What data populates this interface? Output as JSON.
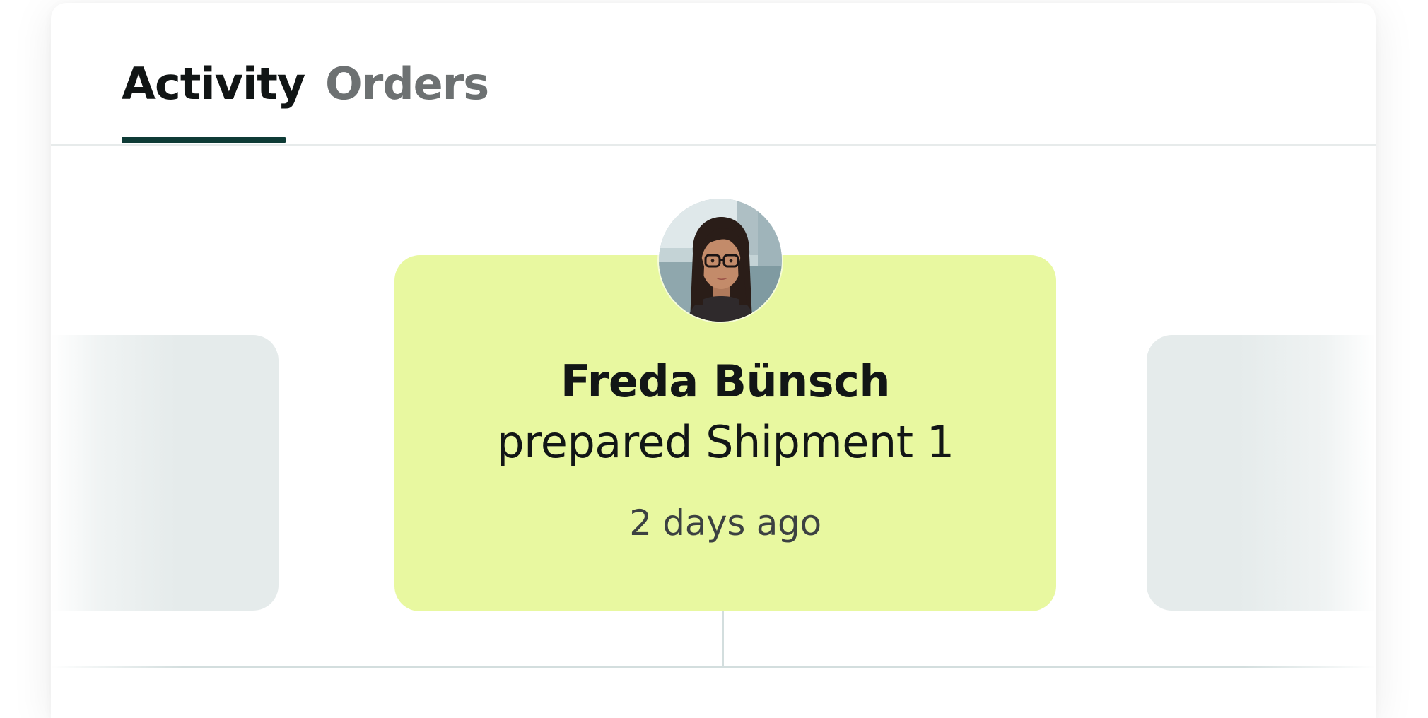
{
  "tabs": [
    {
      "label": "Activity",
      "active": true
    },
    {
      "label": "Orders",
      "active": false
    }
  ],
  "activity": {
    "user_name": "Freda Bünsch",
    "action": "prepared Shipment 1",
    "time": "2 days ago",
    "avatar": "avatar-photo"
  },
  "colors": {
    "active_tab_underline": "#0e3b36",
    "card_background": "#e8f8a0",
    "side_card_background": "#e5ebeb",
    "inactive_tab_text": "#6d7172"
  }
}
